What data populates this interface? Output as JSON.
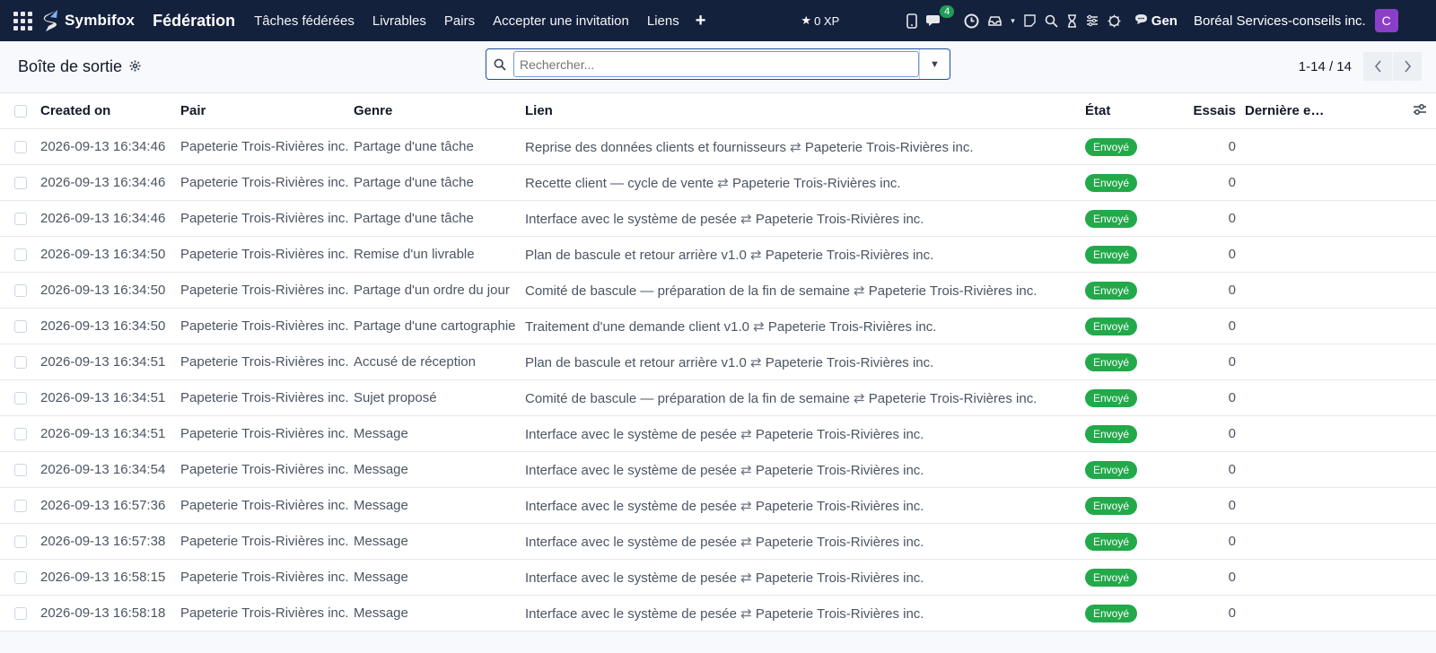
{
  "brand": {
    "logo_text": "Symbifox",
    "app_name": "Fédération"
  },
  "nav": {
    "items": [
      "Tâches fédérées",
      "Livrables",
      "Pairs",
      "Accepter une invitation",
      "Liens"
    ],
    "plus": "+"
  },
  "systray": {
    "xp": "0 XP",
    "chat_count": "4",
    "gen_label": "Gen",
    "company": "Boréal Services-conseils inc.",
    "avatar_letter": "C",
    "avatar_color": "#8b3fc9"
  },
  "control": {
    "breadcrumb": "Boîte de sortie",
    "search_placeholder": "Rechercher...",
    "pager": "1-14 / 14"
  },
  "table": {
    "headers": {
      "created_on": "Created on",
      "pair": "Pair",
      "genre": "Genre",
      "lien": "Lien",
      "etat": "État",
      "essais": "Essais",
      "last": "Dernière er…"
    },
    "rows": [
      {
        "date": "2026-09-13 16:34:46",
        "pair": "Papeterie Trois-Rivières inc.",
        "genre": "Partage d'une tâche",
        "lien_a": "Reprise des données clients et fournisseurs",
        "lien_b": "Papeterie Trois-Rivières inc.",
        "etat": "Envoyé",
        "essais": "0"
      },
      {
        "date": "2026-09-13 16:34:46",
        "pair": "Papeterie Trois-Rivières inc.",
        "genre": "Partage d'une tâche",
        "lien_a": "Recette client — cycle de vente",
        "lien_b": "Papeterie Trois-Rivières inc.",
        "etat": "Envoyé",
        "essais": "0"
      },
      {
        "date": "2026-09-13 16:34:46",
        "pair": "Papeterie Trois-Rivières inc.",
        "genre": "Partage d'une tâche",
        "lien_a": "Interface avec le système de pesée",
        "lien_b": "Papeterie Trois-Rivières inc.",
        "etat": "Envoyé",
        "essais": "0"
      },
      {
        "date": "2026-09-13 16:34:50",
        "pair": "Papeterie Trois-Rivières inc.",
        "genre": "Remise d'un livrable",
        "lien_a": "Plan de bascule et retour arrière v1.0",
        "lien_b": "Papeterie Trois-Rivières inc.",
        "etat": "Envoyé",
        "essais": "0"
      },
      {
        "date": "2026-09-13 16:34:50",
        "pair": "Papeterie Trois-Rivières inc.",
        "genre": "Partage d'un ordre du jour",
        "lien_a": "Comité de bascule — préparation de la fin de semaine",
        "lien_b": "Papeterie Trois-Rivières inc.",
        "etat": "Envoyé",
        "essais": "0"
      },
      {
        "date": "2026-09-13 16:34:50",
        "pair": "Papeterie Trois-Rivières inc.",
        "genre": "Partage d'une cartographie",
        "lien_a": "Traitement d'une demande client v1.0",
        "lien_b": "Papeterie Trois-Rivières inc.",
        "etat": "Envoyé",
        "essais": "0"
      },
      {
        "date": "2026-09-13 16:34:51",
        "pair": "Papeterie Trois-Rivières inc.",
        "genre": "Accusé de réception",
        "lien_a": "Plan de bascule et retour arrière v1.0",
        "lien_b": "Papeterie Trois-Rivières inc.",
        "etat": "Envoyé",
        "essais": "0"
      },
      {
        "date": "2026-09-13 16:34:51",
        "pair": "Papeterie Trois-Rivières inc.",
        "genre": "Sujet proposé",
        "lien_a": "Comité de bascule — préparation de la fin de semaine",
        "lien_b": "Papeterie Trois-Rivières inc.",
        "etat": "Envoyé",
        "essais": "0"
      },
      {
        "date": "2026-09-13 16:34:51",
        "pair": "Papeterie Trois-Rivières inc.",
        "genre": "Message",
        "lien_a": "Interface avec le système de pesée",
        "lien_b": "Papeterie Trois-Rivières inc.",
        "etat": "Envoyé",
        "essais": "0"
      },
      {
        "date": "2026-09-13 16:34:54",
        "pair": "Papeterie Trois-Rivières inc.",
        "genre": "Message",
        "lien_a": "Interface avec le système de pesée",
        "lien_b": "Papeterie Trois-Rivières inc.",
        "etat": "Envoyé",
        "essais": "0"
      },
      {
        "date": "2026-09-13 16:57:36",
        "pair": "Papeterie Trois-Rivières inc.",
        "genre": "Message",
        "lien_a": "Interface avec le système de pesée",
        "lien_b": "Papeterie Trois-Rivières inc.",
        "etat": "Envoyé",
        "essais": "0"
      },
      {
        "date": "2026-09-13 16:57:38",
        "pair": "Papeterie Trois-Rivières inc.",
        "genre": "Message",
        "lien_a": "Interface avec le système de pesée",
        "lien_b": "Papeterie Trois-Rivières inc.",
        "etat": "Envoyé",
        "essais": "0"
      },
      {
        "date": "2026-09-13 16:58:15",
        "pair": "Papeterie Trois-Rivières inc.",
        "genre": "Message",
        "lien_a": "Interface avec le système de pesée",
        "lien_b": "Papeterie Trois-Rivières inc.",
        "etat": "Envoyé",
        "essais": "0"
      },
      {
        "date": "2026-09-13 16:58:18",
        "pair": "Papeterie Trois-Rivières inc.",
        "genre": "Message",
        "lien_a": "Interface avec le système de pesée",
        "lien_b": "Papeterie Trois-Rivières inc.",
        "etat": "Envoyé",
        "essais": "0"
      }
    ],
    "link_arrow": "⇄",
    "status_color": "#22a94a"
  }
}
